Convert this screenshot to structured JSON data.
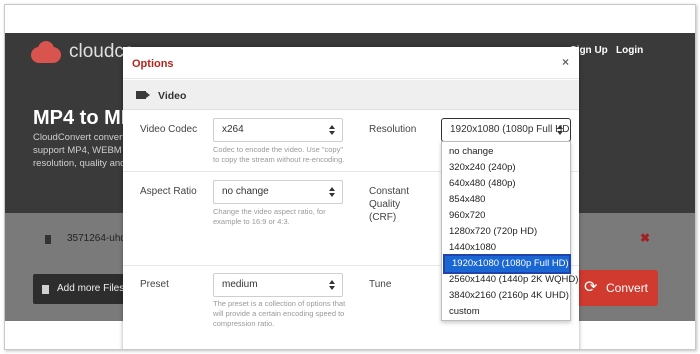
{
  "site": {
    "logo_text": "cloudco",
    "nav": {
      "signup": "Sign Up",
      "login": "Login"
    },
    "hero_title": "MP4 to MK",
    "hero_desc": "CloudConvert convert support MP4, WEBM a resolution, quality and",
    "file_name": "3571264-uhd_",
    "add_files_label": "Add more Files",
    "convert_label": "Convert",
    "remove_symbol": "✖",
    "convert_icon": "⟳",
    "accent_color": "#d03a2f"
  },
  "modal": {
    "title": "Options",
    "close_symbol": "×",
    "section_title": "Video",
    "fields": {
      "video_codec": {
        "label": "Video Codec",
        "value": "x264",
        "help": "Codec to encode the video. Use \"copy\" to copy the stream without re-encoding."
      },
      "resolution": {
        "label": "Resolution",
        "value": "1920x1080 (1080p Full HD"
      },
      "aspect_ratio": {
        "label": "Aspect Ratio",
        "value": "no change",
        "help": "Change the video aspect ratio, for example to 16:9 or 4:3."
      },
      "constant_quality": {
        "label": "Constant Quality (CRF)"
      },
      "preset": {
        "label": "Preset",
        "value": "medium",
        "help": "The preset is a collection of options that will provide a certain encoding speed to compression ratio."
      },
      "tune": {
        "label": "Tune"
      }
    },
    "resolution_options": [
      "no change",
      "320x240 (240p)",
      "640x480 (480p)",
      "854x480",
      "960x720",
      "1280x720 (720p HD)",
      "1440x1080",
      "1920x1080 (1080p Full HD)",
      "2560x1440 (1440p 2K WQHD)",
      "3840x2160 (2160p 4K UHD)",
      "custom"
    ],
    "resolution_selected_index": 7
  }
}
